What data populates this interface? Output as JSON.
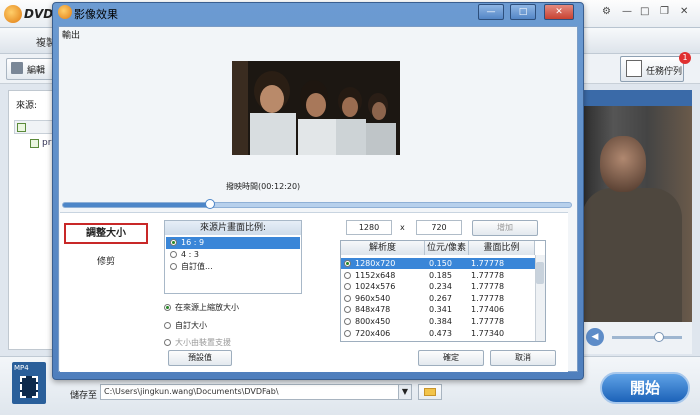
{
  "app": {
    "name": "DVD",
    "tab_label": "複製",
    "edit_label": "編輯",
    "source_label": "來源:",
    "item_label": "pr",
    "queue_label": "任務佇列",
    "queue_badge": "1",
    "start_label": "開始",
    "save_label": "儲存至",
    "save_path": "C:\\Users\\jingkun.wang\\Documents\\DVDFab\\",
    "format_label": "MP4"
  },
  "dialog": {
    "title": "影像效果",
    "output_label": "輸出",
    "play_time": "撥映時間(00:12:20)",
    "min_btn": "—",
    "max_btn": "□",
    "close_btn": "✕"
  },
  "sidebar": {
    "resize": "調整大小",
    "trim": "修剪"
  },
  "aspect": {
    "header": "來源片畫面比例:",
    "options": [
      "16 : 9",
      "4 : 3",
      "自訂值..."
    ]
  },
  "resize_options": [
    "在來源上縮放大小",
    "自訂大小",
    "大小由裝置支援"
  ],
  "preset_button": "預設值",
  "dimension": {
    "width": "1280",
    "x": "x",
    "height": "720",
    "add": "增加"
  },
  "table": {
    "headers": [
      "解析度",
      "位元/像素",
      "畫面比例"
    ],
    "rows": [
      {
        "res": "1280x720",
        "bpp": "0.150",
        "ratio": "1.77778"
      },
      {
        "res": "1152x648",
        "bpp": "0.185",
        "ratio": "1.77778"
      },
      {
        "res": "1024x576",
        "bpp": "0.234",
        "ratio": "1.77778"
      },
      {
        "res": "960x540",
        "bpp": "0.267",
        "ratio": "1.77778"
      },
      {
        "res": "848x478",
        "bpp": "0.341",
        "ratio": "1.77406"
      },
      {
        "res": "800x450",
        "bpp": "0.384",
        "ratio": "1.77778"
      },
      {
        "res": "720x406",
        "bpp": "0.473",
        "ratio": "1.77340"
      }
    ]
  },
  "buttons": {
    "ok": "確定",
    "cancel": "取消"
  },
  "slider_progress": 0.29
}
